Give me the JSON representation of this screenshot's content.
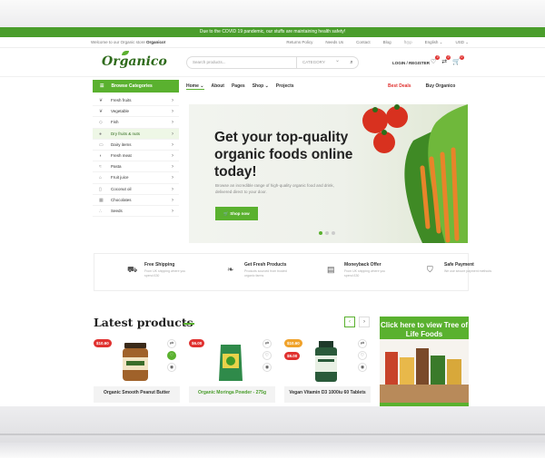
{
  "topbar": {
    "message": "Due to the COVID 19 pandemic, our stuffs are maintaining health safety!"
  },
  "subbar": {
    "welcome": "Welcome to our Organic store",
    "welcome_brand": "Organico!",
    "links": [
      "Returns Policy",
      "Needs Us",
      "Contact",
      "Blog"
    ],
    "language": "English",
    "currency": "USD"
  },
  "header": {
    "logo": "Organico",
    "search_placeholder": "Search products...",
    "category_label": "CATEGORY",
    "login": "LOGIN / REGISTER",
    "wishlist_count": "0",
    "compare_count": "0",
    "cart_count": "0"
  },
  "nav": {
    "browse": "Browse Categories",
    "links": [
      "Home",
      "About",
      "Pages",
      "Shop",
      "Projects"
    ],
    "best_deals": "Best Deals",
    "buy": "Buy Organico"
  },
  "categories": [
    "Fresh fruits",
    "Vegetable",
    "Fish",
    "Dry fruits & nuts",
    "Dairy items",
    "Fresh meat",
    "Pasta",
    "Fruit juice",
    "Coconut oil",
    "Chocolates",
    "Seeds"
  ],
  "hero": {
    "title": "Get your top-quality organic foods online today!",
    "text": "Browse an incredible range of high-quality organic food and drink, delivered direct to your door.",
    "cta": "Shop now"
  },
  "features": [
    {
      "title": "Free Shipping",
      "text": "From UK shipping where you spend £30"
    },
    {
      "title": "Get Fresh Products",
      "text": "Products sourced from trusted organic farms"
    },
    {
      "title": "Moneyback Offer",
      "text": "From UK shipping where you spend £30"
    },
    {
      "title": "Safe Payment",
      "text": "We use secure payment methods"
    }
  ],
  "latest": {
    "title": "Latest products"
  },
  "products": [
    {
      "price": "$10.60",
      "name": "Organic Smooth Peanut Butter"
    },
    {
      "price": "$6.00",
      "name": "Organic Moringa Powder - 275g"
    },
    {
      "price": "$10.60",
      "price2": "$9.00",
      "name": "Vegan Vitamin D3 1000iu 60 Tablets"
    }
  ],
  "promo": {
    "title": "Click here to view Tree of Life Foods"
  },
  "colors": {
    "green": "#5ab12f",
    "dark_green": "#2f6b1c",
    "red": "#e0312f"
  }
}
